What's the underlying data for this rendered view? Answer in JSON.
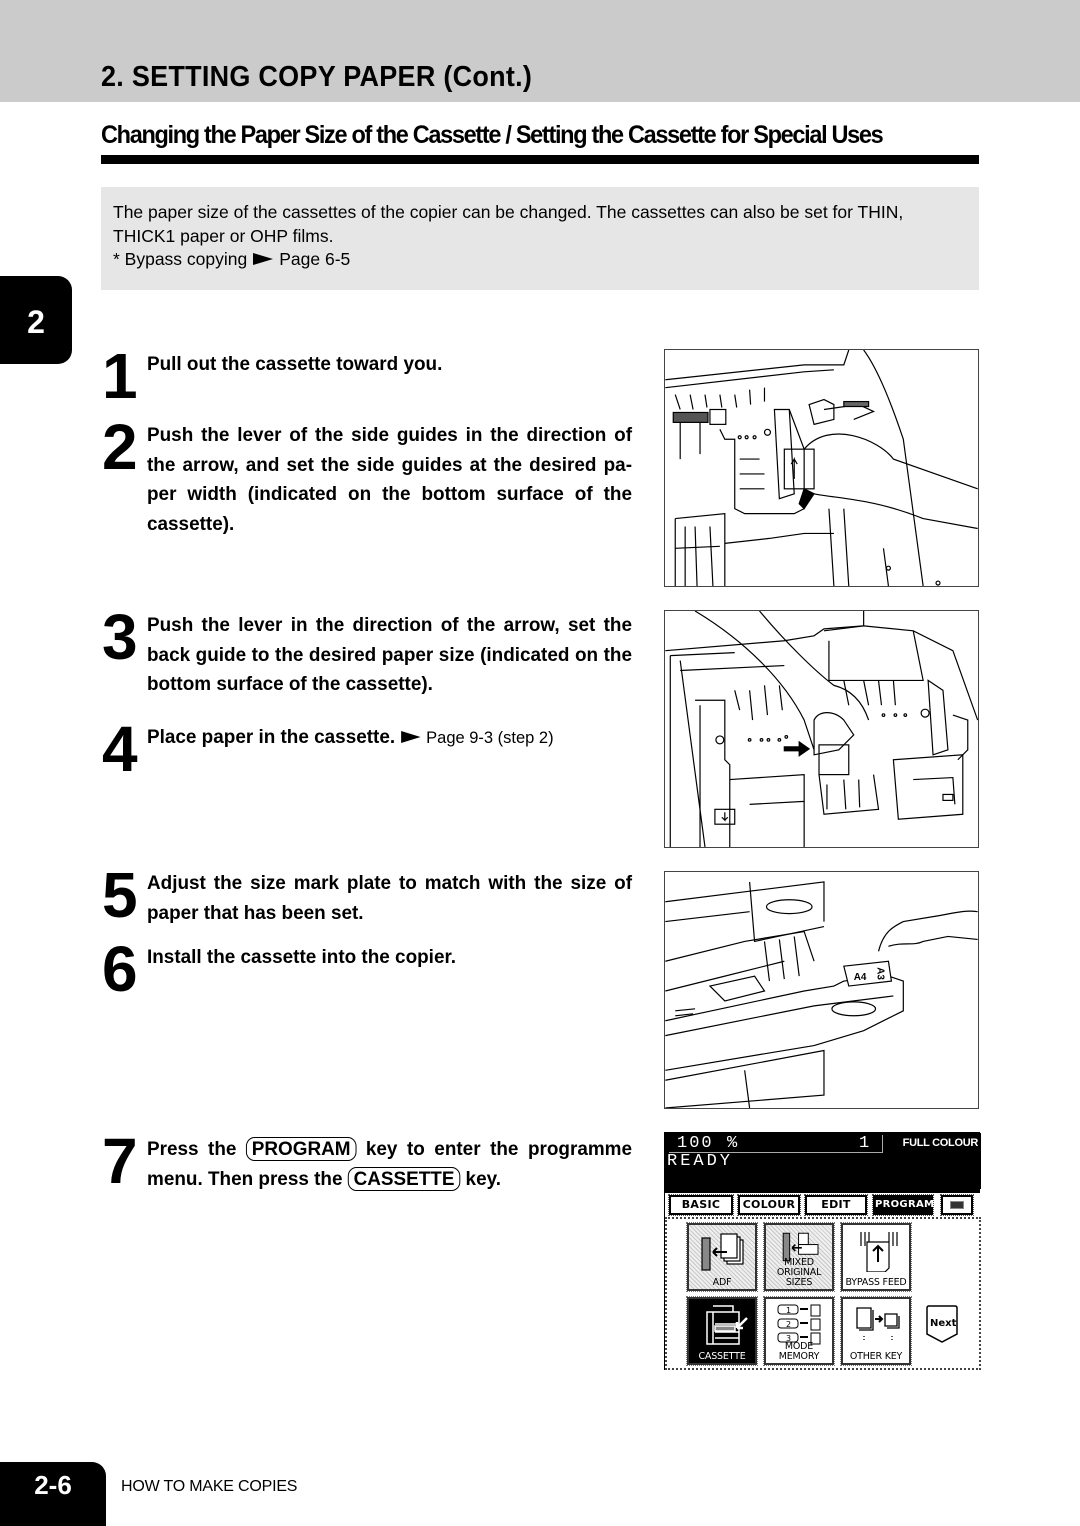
{
  "header": {
    "title": "2. SETTING COPY PAPER (Cont.)",
    "section_title": "Changing the Paper Size of the Cassette / Setting the Cassette for Special Uses"
  },
  "intro": {
    "line1": "The paper size of the cassettes of the copier can be changed.  The cassettes can also be set for THIN,",
    "line2": "THICK1 paper or OHP films.",
    "note_prefix": "* Bypass copying",
    "note_ref": "Page 6-5"
  },
  "chapter_tab": "2",
  "steps": [
    {
      "num": "1",
      "text": "Pull out the cassette toward you."
    },
    {
      "num": "2",
      "text": "Push the lever of the side guides in the direction of the arrow, and set the side guides at the desired pa-per width (indicated on the bottom surface of the cassette)."
    },
    {
      "num": "3",
      "text": "Push the lever in the direction of the arrow, set the back guide to the desired paper size (indicated on the bottom surface of the cassette)."
    },
    {
      "num": "4",
      "text": "Place paper in the cassette.",
      "ref": "Page 9-3 (step 2)"
    },
    {
      "num": "5",
      "text": "Adjust the size mark plate to match with the size of paper that has been set."
    },
    {
      "num": "6",
      "text": "Install the cassette into the copier."
    },
    {
      "num": "7",
      "text_a": "Press the",
      "key_a": "PROGRAM",
      "text_b": "key to enter the programme menu.  Then press the",
      "key_b": "CASSETTE",
      "text_c": "key."
    }
  ],
  "figures": {
    "fig3_plate_a": "A4",
    "fig3_plate_b": "A3"
  },
  "panel": {
    "zoom": "100",
    "percent": "%",
    "count": "1",
    "mode": "FULL COLOUR",
    "status": "READY",
    "tabs": [
      {
        "label": "BASIC",
        "active": false
      },
      {
        "label": "COLOUR",
        "active": false
      },
      {
        "label": "EDIT",
        "active": false
      },
      {
        "label": "PROGRAM",
        "active": true
      },
      {
        "label": "",
        "icon": "screen-icon",
        "active": false
      }
    ],
    "functions": [
      {
        "label": "ADF",
        "state": "shaded"
      },
      {
        "label": "MIXED\nORIGINAL SIZES",
        "label_a": "MIXED",
        "label_b": "ORIGINAL SIZES",
        "state": "shaded"
      },
      {
        "label": "BYPASS FEED",
        "state": "normal"
      },
      {
        "label": "CASSETTE",
        "state": "active"
      },
      {
        "label": "MODE MEMORY",
        "state": "normal",
        "slots": [
          "1",
          "2",
          "3"
        ]
      },
      {
        "label": "OTHER KEY",
        "state": "normal"
      }
    ],
    "next_label": "Next"
  },
  "footer": {
    "page_number": "2-6",
    "chapter_name": "HOW TO MAKE COPIES"
  }
}
